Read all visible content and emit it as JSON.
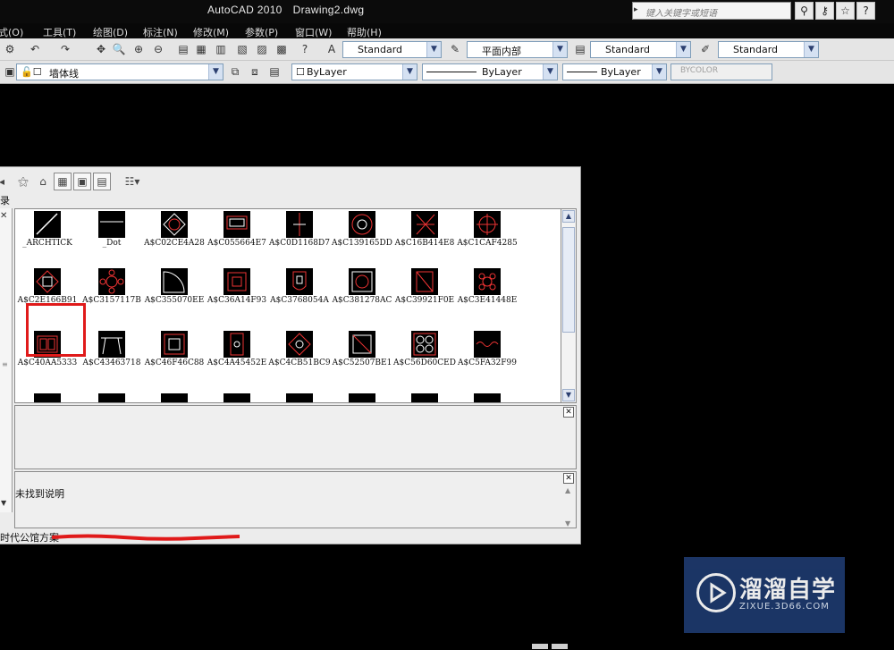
{
  "window": {
    "app_title": "AutoCAD 2010",
    "doc_title": "Drawing2.dwg",
    "search_placeholder": "键入关键字或短语",
    "icons": [
      "binoculars-icon",
      "key-icon",
      "star-icon",
      "help-icon"
    ]
  },
  "menu": [
    {
      "label": "式(O)"
    },
    {
      "label": "工具(T)"
    },
    {
      "label": "绘图(D)"
    },
    {
      "label": "标注(N)"
    },
    {
      "label": "修改(M)"
    },
    {
      "label": "参数(P)"
    },
    {
      "label": "窗口(W)"
    },
    {
      "label": "帮助(H)"
    }
  ],
  "toolbar1": {
    "text_style": "Standard",
    "dim_style": "平面内部",
    "table_style": "Standard",
    "mleader_style": "Standard"
  },
  "toolbar2": {
    "layer": "墙体线",
    "color": "ByLayer",
    "linetype": "ByLayer",
    "lineweight": "ByLayer",
    "plotstyle": "BYCOLOR"
  },
  "dialog": {
    "tree_label": "录",
    "description": "未找到说明",
    "status": "时代公馆方案"
  },
  "blocks": [
    {
      "name": "_ARCHTICK"
    },
    {
      "name": "_Dot"
    },
    {
      "name": "A$C02CE4A28"
    },
    {
      "name": "A$C055664E7"
    },
    {
      "name": "A$C0D1168D7"
    },
    {
      "name": "A$C139165DD"
    },
    {
      "name": "A$C16B414E8"
    },
    {
      "name": "A$C1CAF4285"
    },
    {
      "name": "A$C2E166B91"
    },
    {
      "name": "A$C3157117B"
    },
    {
      "name": "A$C355070EE"
    },
    {
      "name": "A$C36A14F93"
    },
    {
      "name": "A$C3768054A"
    },
    {
      "name": "A$C381278AC"
    },
    {
      "name": "A$C39921F0E"
    },
    {
      "name": "A$C3E41448E"
    },
    {
      "name": "A$C40AA5333"
    },
    {
      "name": "A$C43463718"
    },
    {
      "name": "A$C46F46C88"
    },
    {
      "name": "A$C4A45452E"
    },
    {
      "name": "A$C4CB51BC9"
    },
    {
      "name": "A$C52507BE1"
    },
    {
      "name": "A$C56D60CED"
    },
    {
      "name": "A$C5FA32F99"
    }
  ],
  "watermark": {
    "title": "溜溜自学",
    "sub": "ZIXUE.3D66.COM"
  }
}
